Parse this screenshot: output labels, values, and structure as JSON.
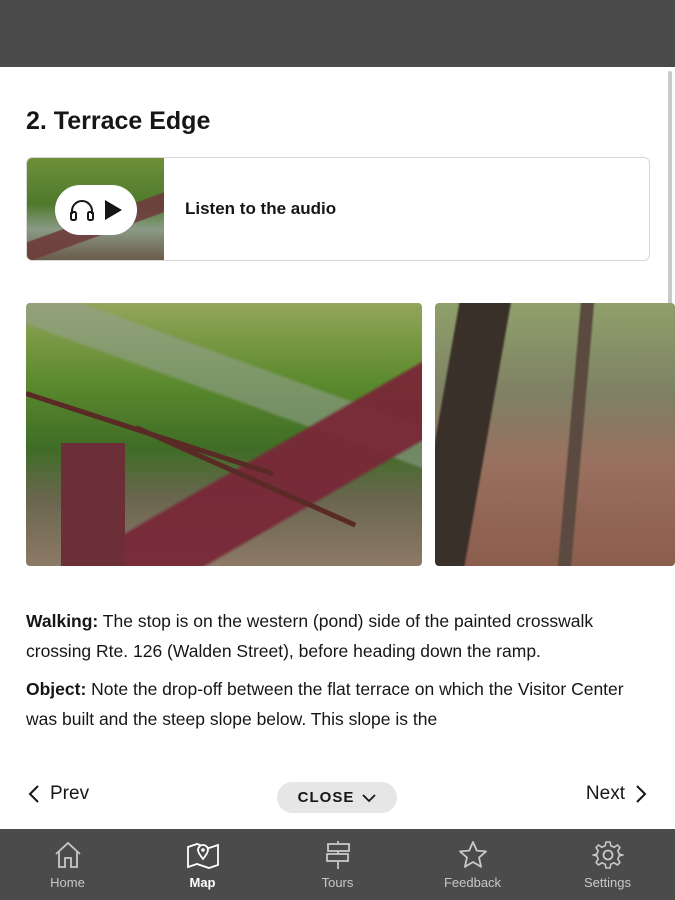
{
  "stop": {
    "title": "2. Terrace Edge",
    "audio_label": "Listen to the audio"
  },
  "gallery": {
    "photos": [
      "stair-railing-photo",
      "wooded-slope-photo"
    ]
  },
  "content": {
    "walking_label": "Walking:",
    "walking_text": " The stop is on the western (pond) side of the painted crosswalk crossing Rte. 126 (Walden Street), before heading down the ramp.",
    "object_label": "Object:",
    "object_text": " Note the drop-off between the flat terrace on which the Visitor Center was built and the steep slope below. This slope is the"
  },
  "navigation": {
    "prev_label": "Prev",
    "close_label": "CLOSE",
    "next_label": "Next"
  },
  "tab_bar": {
    "active": "Map",
    "tabs": [
      {
        "label": "Home",
        "icon": "home-icon"
      },
      {
        "label": "Map",
        "icon": "map-icon"
      },
      {
        "label": "Tours",
        "icon": "signpost-icon"
      },
      {
        "label": "Feedback",
        "icon": "star-icon"
      },
      {
        "label": "Settings",
        "icon": "gear-icon"
      }
    ]
  },
  "colors": {
    "top_bar": "#4b4b4b",
    "tab_bar": "#4b4b4b",
    "close_button_bg": "#e6e6e6",
    "text": "#161616"
  }
}
